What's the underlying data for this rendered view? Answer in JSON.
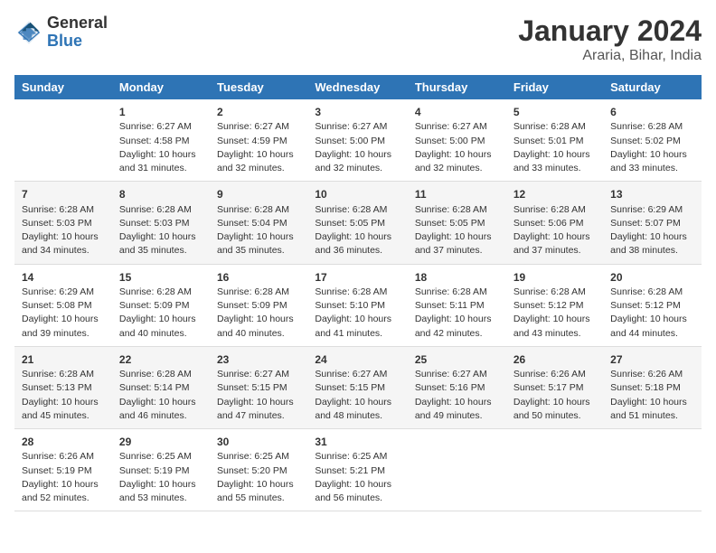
{
  "header": {
    "logo_line1": "General",
    "logo_line2": "Blue",
    "title": "January 2024",
    "subtitle": "Araria, Bihar, India"
  },
  "days_of_week": [
    "Sunday",
    "Monday",
    "Tuesday",
    "Wednesday",
    "Thursday",
    "Friday",
    "Saturday"
  ],
  "weeks": [
    [
      {
        "day": "",
        "info": ""
      },
      {
        "day": "1",
        "info": "Sunrise: 6:27 AM\nSunset: 4:58 PM\nDaylight: 10 hours\nand 31 minutes."
      },
      {
        "day": "2",
        "info": "Sunrise: 6:27 AM\nSunset: 4:59 PM\nDaylight: 10 hours\nand 32 minutes."
      },
      {
        "day": "3",
        "info": "Sunrise: 6:27 AM\nSunset: 5:00 PM\nDaylight: 10 hours\nand 32 minutes."
      },
      {
        "day": "4",
        "info": "Sunrise: 6:27 AM\nSunset: 5:00 PM\nDaylight: 10 hours\nand 32 minutes."
      },
      {
        "day": "5",
        "info": "Sunrise: 6:28 AM\nSunset: 5:01 PM\nDaylight: 10 hours\nand 33 minutes."
      },
      {
        "day": "6",
        "info": "Sunrise: 6:28 AM\nSunset: 5:02 PM\nDaylight: 10 hours\nand 33 minutes."
      }
    ],
    [
      {
        "day": "7",
        "info": "Sunrise: 6:28 AM\nSunset: 5:03 PM\nDaylight: 10 hours\nand 34 minutes."
      },
      {
        "day": "8",
        "info": "Sunrise: 6:28 AM\nSunset: 5:03 PM\nDaylight: 10 hours\nand 35 minutes."
      },
      {
        "day": "9",
        "info": "Sunrise: 6:28 AM\nSunset: 5:04 PM\nDaylight: 10 hours\nand 35 minutes."
      },
      {
        "day": "10",
        "info": "Sunrise: 6:28 AM\nSunset: 5:05 PM\nDaylight: 10 hours\nand 36 minutes."
      },
      {
        "day": "11",
        "info": "Sunrise: 6:28 AM\nSunset: 5:05 PM\nDaylight: 10 hours\nand 37 minutes."
      },
      {
        "day": "12",
        "info": "Sunrise: 6:28 AM\nSunset: 5:06 PM\nDaylight: 10 hours\nand 37 minutes."
      },
      {
        "day": "13",
        "info": "Sunrise: 6:29 AM\nSunset: 5:07 PM\nDaylight: 10 hours\nand 38 minutes."
      }
    ],
    [
      {
        "day": "14",
        "info": "Sunrise: 6:29 AM\nSunset: 5:08 PM\nDaylight: 10 hours\nand 39 minutes."
      },
      {
        "day": "15",
        "info": "Sunrise: 6:28 AM\nSunset: 5:09 PM\nDaylight: 10 hours\nand 40 minutes."
      },
      {
        "day": "16",
        "info": "Sunrise: 6:28 AM\nSunset: 5:09 PM\nDaylight: 10 hours\nand 40 minutes."
      },
      {
        "day": "17",
        "info": "Sunrise: 6:28 AM\nSunset: 5:10 PM\nDaylight: 10 hours\nand 41 minutes."
      },
      {
        "day": "18",
        "info": "Sunrise: 6:28 AM\nSunset: 5:11 PM\nDaylight: 10 hours\nand 42 minutes."
      },
      {
        "day": "19",
        "info": "Sunrise: 6:28 AM\nSunset: 5:12 PM\nDaylight: 10 hours\nand 43 minutes."
      },
      {
        "day": "20",
        "info": "Sunrise: 6:28 AM\nSunset: 5:12 PM\nDaylight: 10 hours\nand 44 minutes."
      }
    ],
    [
      {
        "day": "21",
        "info": "Sunrise: 6:28 AM\nSunset: 5:13 PM\nDaylight: 10 hours\nand 45 minutes."
      },
      {
        "day": "22",
        "info": "Sunrise: 6:28 AM\nSunset: 5:14 PM\nDaylight: 10 hours\nand 46 minutes."
      },
      {
        "day": "23",
        "info": "Sunrise: 6:27 AM\nSunset: 5:15 PM\nDaylight: 10 hours\nand 47 minutes."
      },
      {
        "day": "24",
        "info": "Sunrise: 6:27 AM\nSunset: 5:15 PM\nDaylight: 10 hours\nand 48 minutes."
      },
      {
        "day": "25",
        "info": "Sunrise: 6:27 AM\nSunset: 5:16 PM\nDaylight: 10 hours\nand 49 minutes."
      },
      {
        "day": "26",
        "info": "Sunrise: 6:26 AM\nSunset: 5:17 PM\nDaylight: 10 hours\nand 50 minutes."
      },
      {
        "day": "27",
        "info": "Sunrise: 6:26 AM\nSunset: 5:18 PM\nDaylight: 10 hours\nand 51 minutes."
      }
    ],
    [
      {
        "day": "28",
        "info": "Sunrise: 6:26 AM\nSunset: 5:19 PM\nDaylight: 10 hours\nand 52 minutes."
      },
      {
        "day": "29",
        "info": "Sunrise: 6:25 AM\nSunset: 5:19 PM\nDaylight: 10 hours\nand 53 minutes."
      },
      {
        "day": "30",
        "info": "Sunrise: 6:25 AM\nSunset: 5:20 PM\nDaylight: 10 hours\nand 55 minutes."
      },
      {
        "day": "31",
        "info": "Sunrise: 6:25 AM\nSunset: 5:21 PM\nDaylight: 10 hours\nand 56 minutes."
      },
      {
        "day": "",
        "info": ""
      },
      {
        "day": "",
        "info": ""
      },
      {
        "day": "",
        "info": ""
      }
    ]
  ]
}
